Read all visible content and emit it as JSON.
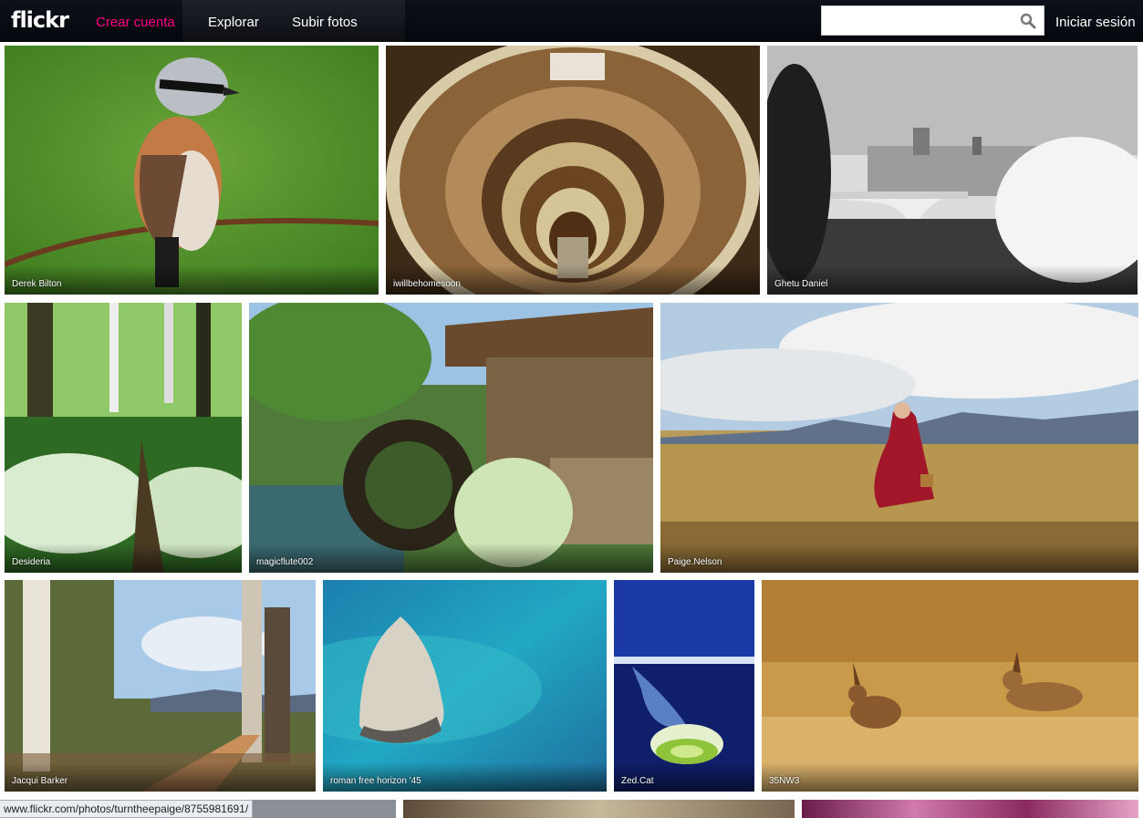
{
  "header": {
    "logo": "flickr",
    "nav": {
      "create_account": "Crear cuenta",
      "explore": "Explorar",
      "upload": "Subir fotos"
    },
    "search": {
      "value": "",
      "placeholder": ""
    },
    "login": "Iniciar sesión"
  },
  "photos": [
    {
      "author": "Derek Bilton",
      "subject": "bird"
    },
    {
      "author": "iwillbehomesoon",
      "subject": "spiral-staircase"
    },
    {
      "author": "Ghetu Daniel",
      "subject": "castle-bridge"
    },
    {
      "author": "Desideria",
      "subject": "forest"
    },
    {
      "author": "magicflute002",
      "subject": "water-wheel"
    },
    {
      "author": "Paige.Nelson",
      "subject": "woman-in-field"
    },
    {
      "author": "Jacqui Barker",
      "subject": "eucalyptus-trees"
    },
    {
      "author": "roman free horizon '45",
      "subject": "sea-rock"
    },
    {
      "author": "Zed.Cat",
      "subject": "leek-splash"
    },
    {
      "author": "35NW3",
      "subject": "hares"
    }
  ],
  "status_url": "www.flickr.com/photos/turntheepaige/8755981691/",
  "colors": {
    "accent": "#ff0084",
    "header_bg": "#0b0e16"
  }
}
